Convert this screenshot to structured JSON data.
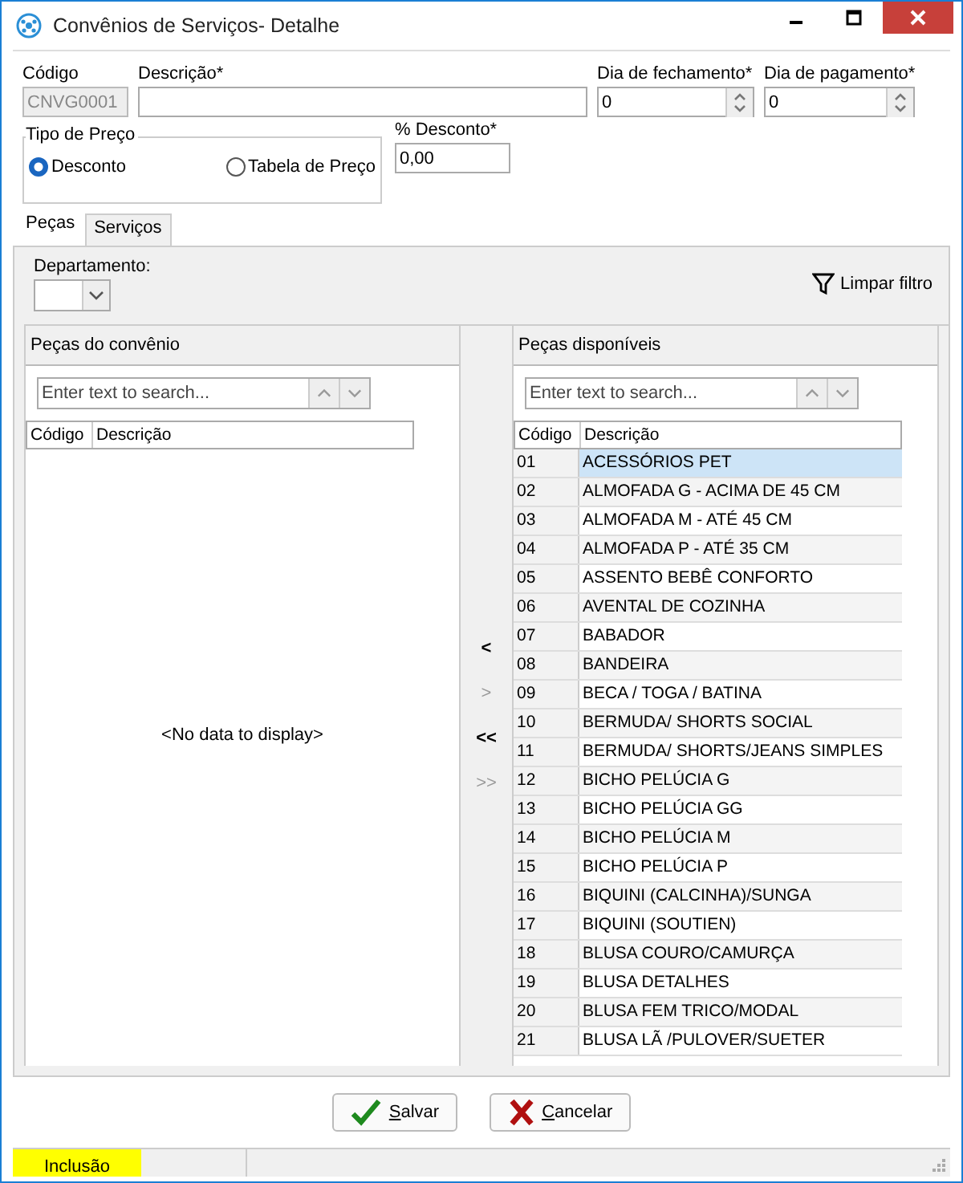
{
  "window": {
    "title": "Convênios de Serviços- Detalhe"
  },
  "form": {
    "codigo": {
      "label": "Código",
      "value": "CNVG0001",
      "disabled": true
    },
    "descricao": {
      "label": "Descrição*"
    },
    "dia_fechamento": {
      "label": "Dia de fechamento*",
      "value": "0"
    },
    "dia_pagamento": {
      "label": "Dia de pagamento*",
      "value": "0"
    },
    "tipo_preco": {
      "label": "Tipo de Preço",
      "options": [
        {
          "label": "Desconto",
          "selected": true
        },
        {
          "label": "Tabela de Preço",
          "selected": false
        }
      ]
    },
    "desconto": {
      "label": "%  Desconto*",
      "value": "0,00"
    }
  },
  "tabs": [
    {
      "label": "Peças",
      "selected": true
    },
    {
      "label": "Serviços",
      "selected": false
    }
  ],
  "filter": {
    "label": "Departamento:",
    "clear_label": "Limpar filtro"
  },
  "left_panel": {
    "title": "Peças do convênio",
    "search_placeholder": "Enter text to search...",
    "columns": [
      "Código",
      "Descrição"
    ],
    "empty_text": "<No data to display>"
  },
  "transfer_buttons": [
    {
      "label": "<",
      "disabled": false
    },
    {
      "label": ">",
      "disabled": true
    },
    {
      "label": "<<",
      "disabled": false
    },
    {
      "label": ">>",
      "disabled": true
    }
  ],
  "right_panel": {
    "title": "Peças disponíveis",
    "search_placeholder": "Enter text to search...",
    "columns": [
      "Código",
      "Descrição"
    ],
    "rows": [
      {
        "code": "01",
        "description": "ACESSÓRIOS PET",
        "selected": true
      },
      {
        "code": "02",
        "description": "ALMOFADA G - ACIMA DE 45 CM",
        "selected": false
      },
      {
        "code": "03",
        "description": "ALMOFADA M - ATÉ 45 CM",
        "selected": false
      },
      {
        "code": "04",
        "description": "ALMOFADA P - ATÉ 35 CM",
        "selected": false
      },
      {
        "code": "05",
        "description": "ASSENTO BEBÊ CONFORTO",
        "selected": false
      },
      {
        "code": "06",
        "description": "AVENTAL DE COZINHA",
        "selected": false
      },
      {
        "code": "07",
        "description": "BABADOR",
        "selected": false
      },
      {
        "code": "08",
        "description": "BANDEIRA",
        "selected": false
      },
      {
        "code": "09",
        "description": "BECA / TOGA / BATINA",
        "selected": false
      },
      {
        "code": "10",
        "description": "BERMUDA/ SHORTS SOCIAL",
        "selected": false
      },
      {
        "code": "11",
        "description": "BERMUDA/ SHORTS/JEANS SIMPLES",
        "selected": false
      },
      {
        "code": "12",
        "description": "BICHO PELÚCIA G",
        "selected": false
      },
      {
        "code": "13",
        "description": "BICHO PELÚCIA GG",
        "selected": false
      },
      {
        "code": "14",
        "description": "BICHO PELÚCIA M",
        "selected": false
      },
      {
        "code": "15",
        "description": "BICHO PELÚCIA P",
        "selected": false
      },
      {
        "code": "16",
        "description": "BIQUINI (CALCINHA)/SUNGA",
        "selected": false
      },
      {
        "code": "17",
        "description": "BIQUINI (SOUTIEN)",
        "selected": false
      },
      {
        "code": "18",
        "description": "BLUSA COURO/CAMURÇA",
        "selected": false
      },
      {
        "code": "19",
        "description": "BLUSA DETALHES",
        "selected": false
      },
      {
        "code": "20",
        "description": "BLUSA FEM TRICO/MODAL",
        "selected": false
      },
      {
        "code": "21",
        "description": "BLUSA LÃ /PULOVER/SUETER",
        "selected": false
      }
    ]
  },
  "buttons": [
    {
      "kind": "save",
      "label": "Salvar"
    },
    {
      "kind": "cancel",
      "label": "Cancelar"
    }
  ],
  "status_bar": {
    "mode": "Inclusão"
  }
}
